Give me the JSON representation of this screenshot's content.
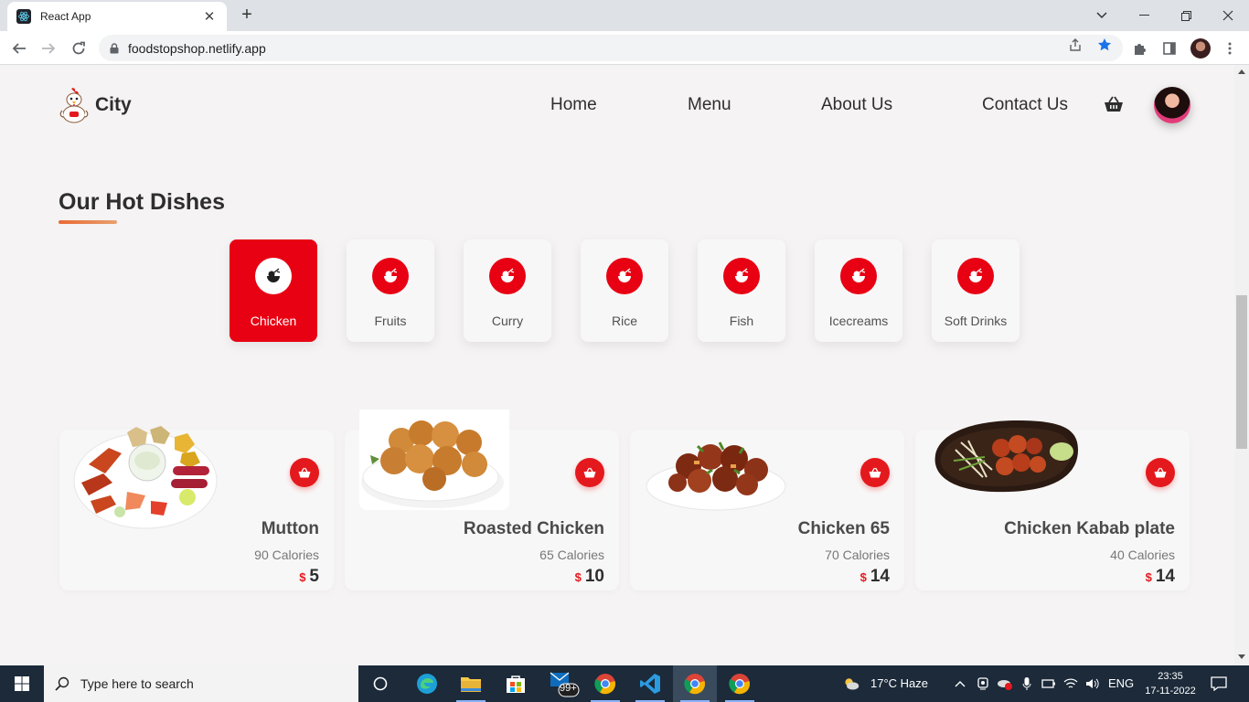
{
  "browser": {
    "tab_title": "React App",
    "url": "foodstopshop.netlify.app",
    "new_tab_label": "+",
    "tab_close_label": "✕"
  },
  "site": {
    "brand": "City",
    "nav": [
      "Home",
      "Menu",
      "About Us",
      "Contact Us"
    ],
    "accent_color": "#e80013"
  },
  "section": {
    "title": "Our Hot Dishes"
  },
  "categories": [
    {
      "label": "Chicken",
      "active": true
    },
    {
      "label": "Fruits",
      "active": false
    },
    {
      "label": "Curry",
      "active": false
    },
    {
      "label": "Rice",
      "active": false
    },
    {
      "label": "Fish",
      "active": false
    },
    {
      "label": "Icecreams",
      "active": false
    },
    {
      "label": "Soft Drinks",
      "active": false
    }
  ],
  "dishes": [
    {
      "name": "Mutton",
      "calories": "90 Calories",
      "currency": "$",
      "price": "5"
    },
    {
      "name": "Roasted Chicken",
      "calories": "65 Calories",
      "currency": "$",
      "price": "10"
    },
    {
      "name": "Chicken 65",
      "calories": "70 Calories",
      "currency": "$",
      "price": "14"
    },
    {
      "name": "Chicken Kabab plate",
      "calories": "40 Calories",
      "currency": "$",
      "price": "14"
    }
  ],
  "taskbar": {
    "search_placeholder": "Type here to search",
    "badge": "99+",
    "weather": "17°C  Haze",
    "lang": "ENG",
    "time": "23:35",
    "date": "17-11-2022"
  }
}
